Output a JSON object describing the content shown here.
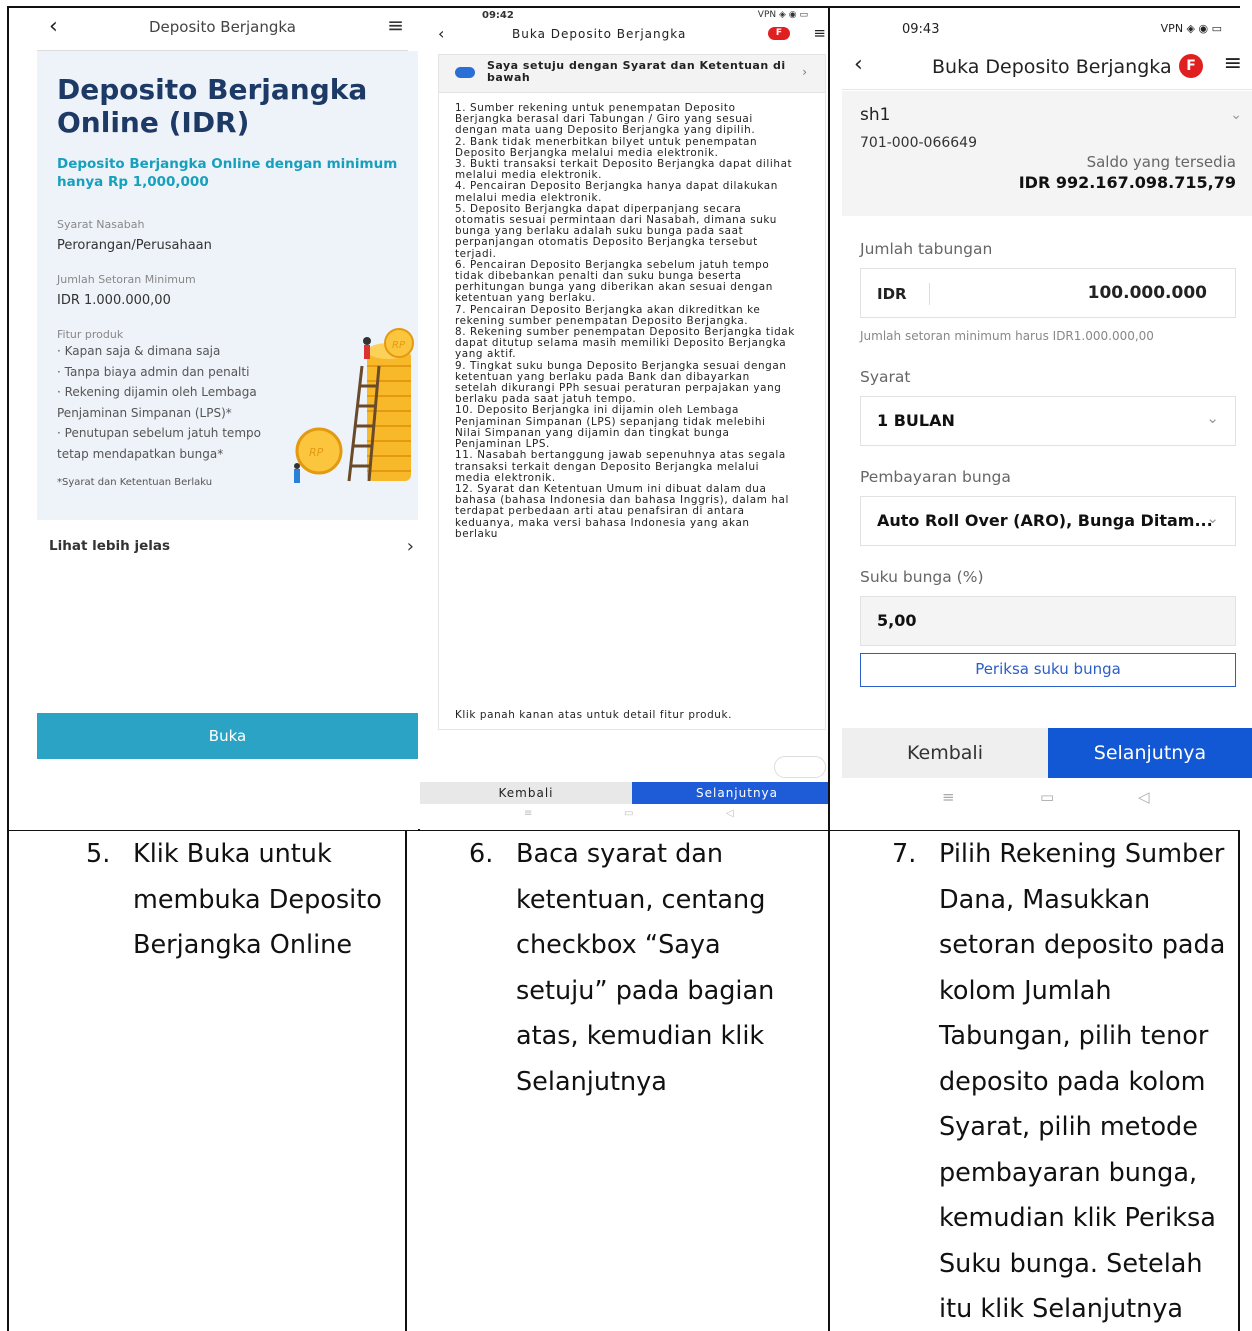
{
  "panel1": {
    "header_title": "Deposito Berjangka",
    "title": "Deposito Berjangka Online (IDR)",
    "subtitle": "Deposito Berjangka Online dengan minimum hanya Rp 1,000,000",
    "syarat_label": "Syarat Nasabah",
    "syarat_value": "Perorangan/Perusahaan",
    "minimum_label": "Jumlah Setoran Minimum",
    "minimum_value": "IDR 1.000.000,00",
    "fitur_label": "Fitur produk",
    "features": [
      "· Kapan saja & dimana saja",
      "· Tanpa biaya admin dan penalti",
      "· Rekening dijamin oleh Lembaga Penjaminan Simpanan (LPS)*",
      "· Penutupan sebelum jatuh tempo tetap mendapatkan bunga*"
    ],
    "note": "*Syarat dan Ketentuan Berlaku",
    "more_link": "Lihat lebih jelas",
    "open_button": "Buka",
    "coin_label": "RP"
  },
  "panel2": {
    "status_time": "09:42",
    "status_vpn": "VPN",
    "header_title": "Buka Deposito Berjangka",
    "badge": "F",
    "agree_text": "Saya setuju dengan Syarat dan Ketentuan di bawah",
    "terms": [
      "1. Sumber rekening untuk penempatan Deposito Berjangka berasal dari Tabungan / Giro yang sesuai dengan mata uang Deposito Berjangka yang dipilih.",
      "2. Bank tidak menerbitkan bilyet untuk penempatan Deposito Berjangka melalui media elektronik.",
      "3. Bukti transaksi terkait Deposito Berjangka dapat dilihat melalui media elektronik.",
      "4. Pencairan Deposito Berjangka hanya dapat dilakukan melalui media elektronik.",
      "5. Deposito Berjangka dapat diperpanjang secara otomatis sesuai permintaan dari Nasabah, dimana suku bunga yang berlaku adalah suku bunga pada saat perpanjangan otomatis Deposito Berjangka tersebut terjadi.",
      "6. Pencairan Deposito Berjangka sebelum jatuh tempo tidak dibebankan penalti dan suku bunga beserta perhitungan bunga yang diberikan akan sesuai dengan ketentuan yang berlaku.",
      "7. Pencairan Deposito Berjangka akan dikreditkan ke rekening sumber penempatan Deposito Berjangka.",
      "8. Rekening sumber penempatan Deposito Berjangka tidak dapat ditutup selama masih memiliki Deposito Berjangka yang aktif.",
      "9. Tingkat suku bunga Deposito Berjangka sesuai dengan ketentuan yang berlaku pada Bank dan dibayarkan setelah dikurangi PPh sesuai peraturan perpajakan yang berlaku pada saat jatuh tempo.",
      "10. Deposito Berjangka ini dijamin oleh Lembaga Penjaminan Simpanan (LPS) sepanjang tidak melebihi Nilai Simpanan yang dijamin dan tingkat bunga Penjaminan LPS.",
      "11. Nasabah bertanggung jawab sepenuhnya atas segala transaksi terkait dengan Deposito Berjangka melalui media elektronik.",
      "12. Syarat dan Ketentuan Umum ini dibuat dalam dua bahasa (bahasa Indonesia dan bahasa Inggris), dalam hal terdapat perbedaan arti atau penafsiran di antara keduanya, maka versi bahasa Indonesia yang akan berlaku"
    ],
    "footer_text": "Klik panah kanan atas untuk detail fitur produk.",
    "back_button": "Kembali",
    "next_button": "Selanjutnya"
  },
  "panel3": {
    "status_time": "09:43",
    "status_vpn": "VPN",
    "header_title": "Buka Deposito Berjangka",
    "badge": "F",
    "account_name": "sh1",
    "account_number": "701-000-066649",
    "saldo_label": "Saldo yang tersedia",
    "saldo_value": "IDR 992.167.098.715,79",
    "jumlah_label": "Jumlah tabungan",
    "currency": "IDR",
    "amount": "100.000.000",
    "hint": "Jumlah setoran minimum harus IDR1.000.000,00",
    "syarat_label": "Syarat",
    "syarat_value": "1 BULAN",
    "pembayaran_label": "Pembayaran bunga",
    "pembayaran_value": "Auto Roll Over (ARO), Bunga Ditam...",
    "suku_label": "Suku bunga (%)",
    "suku_value": "5,00",
    "check_button": "Periksa suku bunga",
    "back_button": "Kembali",
    "next_button": "Selanjutnya"
  },
  "captions": [
    {
      "number": "5.",
      "text": "Klik Buka untuk membuka Deposito Berjangka Online"
    },
    {
      "number": "6.",
      "text": "Baca syarat dan ketentuan, centang checkbox “Saya setuju” pada bagian atas, kemudian klik Selanjutnya"
    },
    {
      "number": "7.",
      "text": "Pilih Rekening Sumber Dana, Masukkan setoran deposito pada kolom Jumlah Tabungan, pilih tenor deposito pada kolom Syarat, pilih metode pembayaran bunga, kemudian klik Periksa Suku bunga. Setelah itu klik Selanjutnya"
    }
  ]
}
